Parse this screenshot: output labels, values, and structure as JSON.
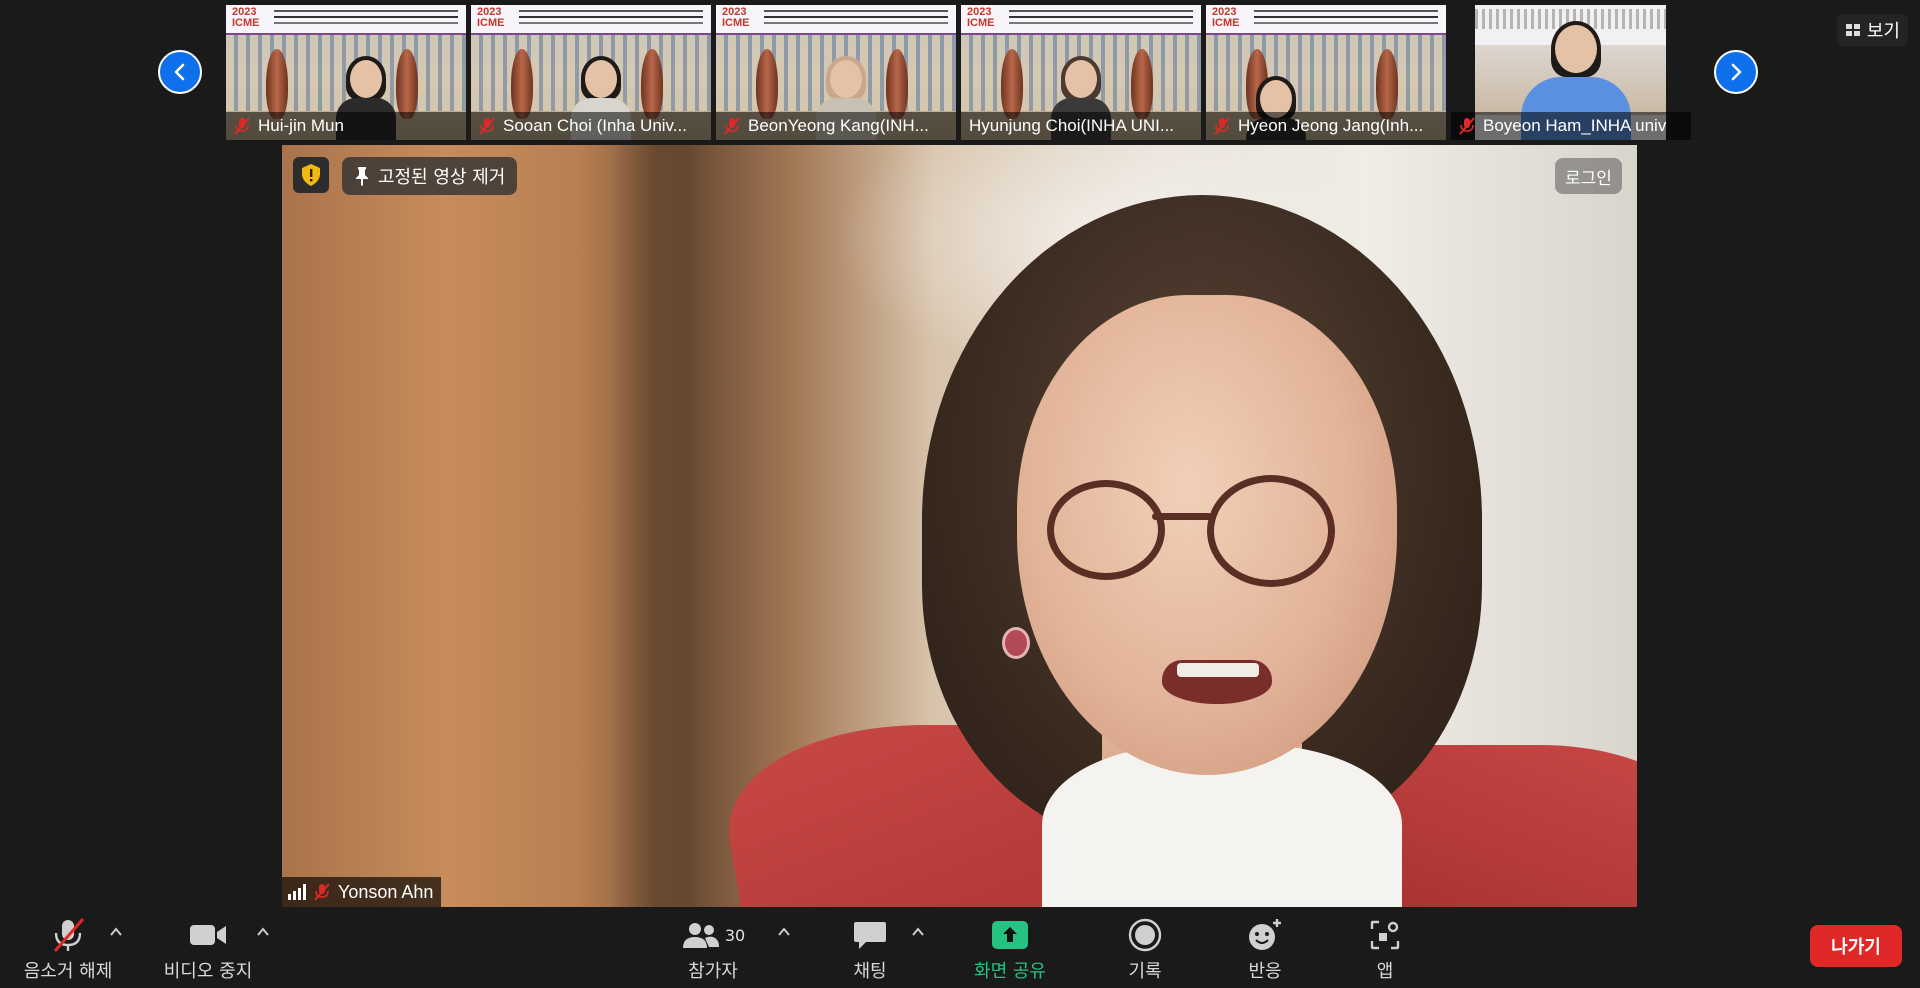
{
  "top_bar": {
    "view_label": "보기",
    "thumbnails": [
      {
        "name": "Hui-jin Mun",
        "muted": true
      },
      {
        "name": "Sooan Choi (Inha Univ...",
        "muted": true
      },
      {
        "name": "BeonYeong Kang(INH...",
        "muted": true
      },
      {
        "name": "Hyunjung Choi(INHA UNI...",
        "muted": false
      },
      {
        "name": "Hyeon Jeong Jang(Inh...",
        "muted": true
      },
      {
        "name": "Boyeon Ham_INHA univ",
        "muted": true
      }
    ],
    "banner_year": "2023",
    "banner_abbr": "ICME"
  },
  "main_video": {
    "speaker_name": "Yonson Ahn",
    "speaker_muted": true,
    "unpin_label": "고정된 영상 제거",
    "login_label": "로그인"
  },
  "toolbar": {
    "unmute_label": "음소거 해제",
    "stop_video_label": "비디오 중지",
    "participants_label": "참가자",
    "participants_count": "30",
    "chat_label": "채팅",
    "share_label": "화면 공유",
    "record_label": "기록",
    "reactions_label": "반응",
    "apps_label": "앱",
    "leave_label": "나가기"
  },
  "colors": {
    "background": "#1a1a1a",
    "accent_blue": "#0e71eb",
    "share_green": "#26c281",
    "leave_red": "#e02828",
    "muted_red": "#e02828"
  }
}
